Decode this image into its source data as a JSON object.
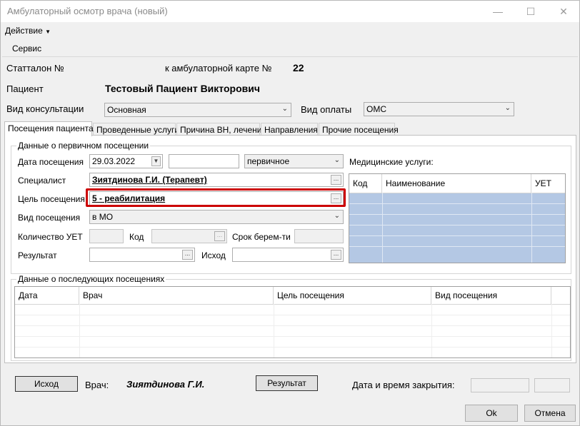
{
  "window": {
    "title": "Амбулаторный осмотр врача (новый)"
  },
  "menu": {
    "action": "Действие",
    "service": "Сервис"
  },
  "header": {
    "stattalon_label": "Статталон №",
    "card_label": "к амбулаторной карте №",
    "card_number": "22",
    "patient_label": "Пациент",
    "patient_name": "Тестовый Пациент Викторович",
    "consult_label": "Вид консультации",
    "consult_value": "Основная",
    "payment_label": "Вид оплаты",
    "payment_value": "ОМС"
  },
  "tabs": [
    "Посещения пациента",
    "Проведенные услуги",
    "Причина ВН, лечение",
    "Направления",
    "Прочие посещения"
  ],
  "primary_visit": {
    "legend": "Данные о первичном посещении",
    "date_label": "Дата посещения",
    "date_value": "29.03.2022",
    "time_value": "",
    "visit_type_value": "первичное",
    "specialist_label": "Специалист",
    "specialist_value": "Зиятдинова Г.И. (Терапевт)",
    "purpose_label": "Цель посещения",
    "purpose_value": "5 - реабилитация",
    "kind_label": "Вид посещения",
    "kind_value": "в МО",
    "uet_label": "Количество УЕТ",
    "code_label": "Код",
    "term_label": "Срок берем-ти",
    "result_label": "Результат",
    "outcome_label": "Исход"
  },
  "services": {
    "label": "Медицинские услуги:",
    "columns": [
      "Код",
      "Наименование",
      "УЕТ"
    ]
  },
  "next_visits": {
    "legend": "Данные о последующих посещениях",
    "columns": [
      "Дата",
      "Врач",
      "Цель посещения",
      "Вид посещения"
    ]
  },
  "footer": {
    "outcome_button": "Исход",
    "doctor_label": "Врач:",
    "doctor_name": "Зиятдинова Г.И.",
    "result_button": "Результат",
    "close_label": "Дата и время закрытия:",
    "ok_button": "Ok",
    "cancel_button": "Отмена"
  },
  "colors": {
    "highlight": "#cc0000",
    "grid_fill": "#b4c8e4"
  }
}
